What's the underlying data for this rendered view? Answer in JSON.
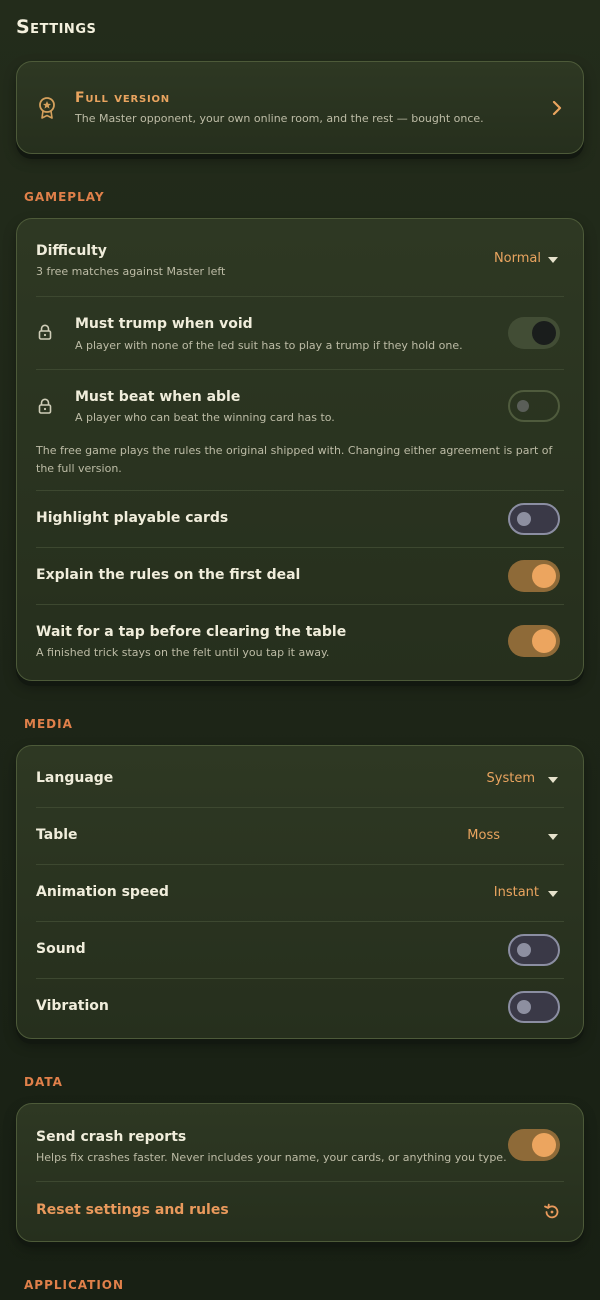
{
  "page": {
    "title": "Settings"
  },
  "full_version": {
    "title": "Full version",
    "description": "The Master opponent, your own online room, and the rest — bought once.",
    "icon": "award-icon",
    "chevron_icon": "chevron-right-icon"
  },
  "gameplay": {
    "section_label": "GAMEPLAY",
    "difficulty": {
      "title": "Difficulty",
      "subtitle": "3 free matches against Master left",
      "value": "Normal"
    },
    "must_trump": {
      "title": "Must trump when void",
      "subtitle": "A player with none of the led suit has to play a trump if they hold one.",
      "on": true,
      "locked": true
    },
    "must_beat": {
      "title": "Must beat when able",
      "subtitle": "A player who can beat the winning card has to.",
      "on": false,
      "locked": true
    },
    "note": "The free game plays the rules the original shipped with. Changing either agreement is part of the full version.",
    "highlight": {
      "title": "Highlight playable cards",
      "on": false
    },
    "explain": {
      "title": "Explain the rules on the first deal",
      "on": true
    },
    "wait_tap": {
      "title": "Wait for a tap before clearing the table",
      "subtitle": "A finished trick stays on the felt until you tap it away.",
      "on": true
    }
  },
  "media": {
    "section_label": "MEDIA",
    "language": {
      "title": "Language",
      "value": "System"
    },
    "table": {
      "title": "Table",
      "value": "Moss"
    },
    "animation": {
      "title": "Animation speed",
      "value": "Instant"
    },
    "sound": {
      "title": "Sound",
      "on": false
    },
    "vibration": {
      "title": "Vibration",
      "on": false
    }
  },
  "data_section": {
    "section_label": "DATA",
    "crash": {
      "title": "Send crash reports",
      "subtitle": "Helps fix crashes faster. Never includes your name, your cards, or anything you type.",
      "on": true
    },
    "reset": {
      "title": "Reset settings and rules",
      "icon": "reset-icon"
    }
  },
  "application": {
    "section_label": "APPLICATION"
  },
  "colors": {
    "accent": "#e9a45f",
    "section_label": "#e0804a",
    "background": "#1e2618",
    "card": "#2a3420"
  }
}
